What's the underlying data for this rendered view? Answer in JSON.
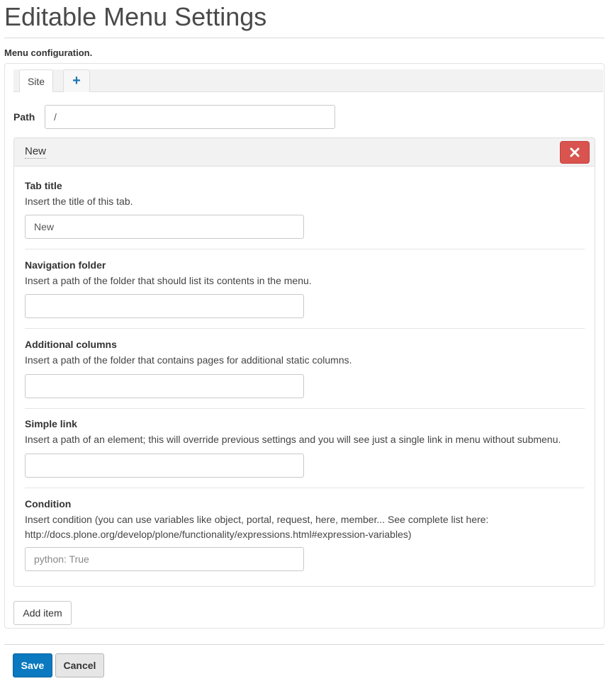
{
  "page": {
    "title": "Editable Menu Settings",
    "section_label": "Menu configuration."
  },
  "tabs": {
    "site_label": "Site",
    "add_label": "+"
  },
  "path": {
    "label": "Path",
    "value": "/"
  },
  "item": {
    "title": "New",
    "remove_icon": "close-icon",
    "fields": [
      {
        "label": "Tab title",
        "help": "Insert the title of this tab.",
        "value": "New"
      },
      {
        "label": "Navigation folder",
        "help": "Insert a path of the folder that should list its contents in the menu.",
        "value": ""
      },
      {
        "label": "Additional columns",
        "help": "Insert a path of the folder that contains pages for additional static columns.",
        "value": ""
      },
      {
        "label": "Simple link",
        "help": "Insert a path of an element; this will override previous settings and you will see just a single link in menu without submenu.",
        "value": ""
      },
      {
        "label": "Condition",
        "help": "Insert condition (you can use variables like object, portal, request, here, member... See complete list here: http://docs.plone.org/develop/plone/functionality/expressions.html#expression-variables)",
        "placeholder": "python: True"
      }
    ]
  },
  "buttons": {
    "add_item": "Add item",
    "save": "Save",
    "cancel": "Cancel"
  },
  "colors": {
    "save": "#0b79bf",
    "remove": "#d9534f",
    "add_tab": "#1e75b3"
  }
}
